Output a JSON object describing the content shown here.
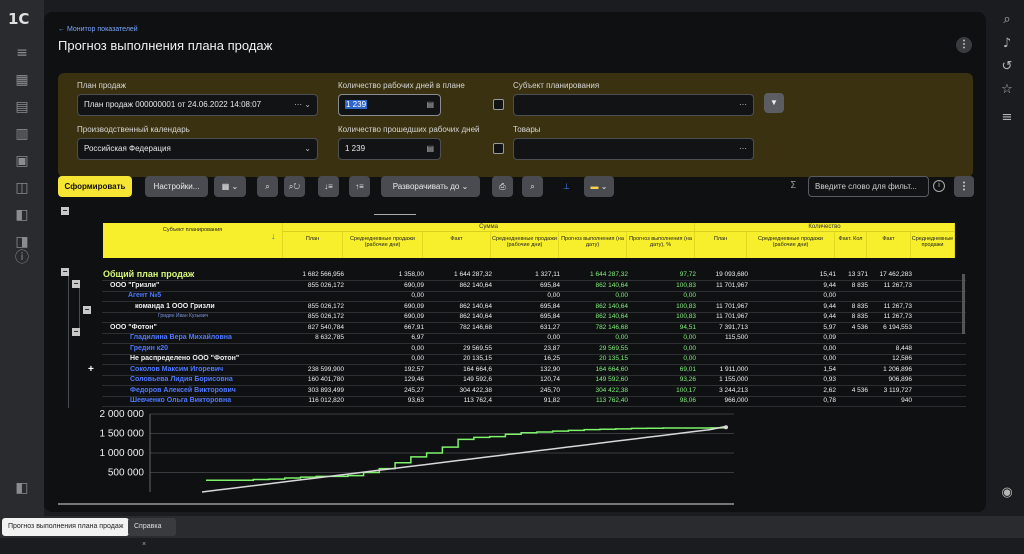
{
  "app": {
    "logo": "1С"
  },
  "header": {
    "back_link": "← Монитор показателей",
    "title": "Прогноз выполнения плана продаж"
  },
  "params": {
    "plan_label": "План продаж",
    "plan_value": "План продаж 000000001 от 24.06.2022 14:08:07",
    "workdays_label": "Количество рабочих дней в плане",
    "workdays_value": "1 239",
    "subject_label": "Субъект планирования",
    "calendar_label": "Производственный календарь",
    "calendar_value": "Российская Федерация",
    "passed_days_label": "Количество прошедших рабочих дней",
    "passed_days_value": "1 239",
    "goods_label": "Товары"
  },
  "toolbar": {
    "form_button": "Сформировать",
    "settings_button": "Настройки...",
    "expand_button": "Разворачивать до",
    "search_placeholder": "Введите слово для фильт...",
    "sigma": "Σ"
  },
  "report": {
    "header": {
      "subject": "Субъект планирования",
      "sums_group": "Сумма",
      "qty_group": "Количество",
      "columns": [
        "План",
        "Среднедневные продажи (рабочие дни)",
        "Факт",
        "Среднедневные продажи (рабочие дни)",
        "Прогноз выполнения (на дату)",
        "Прогноз выполнения (на дату), %"
      ],
      "qty_columns": [
        "План",
        "Среднедневные продажи (рабочие дни)",
        "Факт. Кол",
        "Факт",
        "Среднедневные продажи"
      ]
    },
    "rows": [
      {
        "name": "Общий план продаж",
        "c": [
          "1 682 566,956",
          "1 358,00",
          "1 644 287,32",
          "1 327,11",
          "1 644 287,32",
          "97,72",
          "19 093,680",
          "15,41",
          "13 371",
          "17 462,283"
        ]
      },
      {
        "name": "ООО \"Гризли\"",
        "c": [
          "855 026,172",
          "690,09",
          "862 140,64",
          "695,84",
          "862 140,64",
          "100,83",
          "11 701,967",
          "9,44",
          "8 835",
          "11 267,73"
        ]
      },
      {
        "name": "Агент №5",
        "c": [
          "",
          "0,00",
          "",
          "0,00",
          "0,00",
          "0,00",
          "",
          "0,00",
          "",
          ""
        ]
      },
      {
        "name": "команда 1 ООО Гризли",
        "c": [
          "855 026,172",
          "690,09",
          "862 140,64",
          "695,84",
          "862 140,64",
          "100,83",
          "11 701,967",
          "9,44",
          "8 835",
          "11 267,73"
        ]
      },
      {
        "name": "Гридин Иван Кузьмич",
        "c": [
          "855 026,172",
          "690,09",
          "862 140,64",
          "695,84",
          "862 140,64",
          "100,83",
          "11 701,967",
          "9,44",
          "8 835",
          "11 267,73"
        ]
      },
      {
        "name": "ООО \"Фотон\"",
        "c": [
          "827 540,784",
          "667,91",
          "782 146,68",
          "631,27",
          "782 146,68",
          "94,51",
          "7 391,713",
          "5,97",
          "4 536",
          "6 194,553"
        ]
      },
      {
        "name": "Гладилина Вера Михайловна",
        "c": [
          "8 632,785",
          "6,97",
          "",
          "0,00",
          "0,00",
          "0,00",
          "115,500",
          "0,09",
          "",
          ""
        ]
      },
      {
        "name": "Гредин к20",
        "c": [
          "",
          "0,00",
          "29 569,55",
          "23,87",
          "29 569,55",
          "0,00",
          "",
          "0,00",
          "",
          "8,448"
        ]
      },
      {
        "name": "Не распределено ООО \"Фотон\"",
        "c": [
          "",
          "0,00",
          "20 135,15",
          "16,25",
          "20 135,15",
          "0,00",
          "",
          "0,00",
          "",
          "12,586"
        ]
      },
      {
        "name": "Соколов Максим Игоревич",
        "c": [
          "238 599,900",
          "192,57",
          "164 664,6",
          "132,90",
          "164 664,60",
          "69,01",
          "1 911,000",
          "1,54",
          "",
          "1 206,896"
        ]
      },
      {
        "name": "Соловьева Лидия Борисовна",
        "c": [
          "160 401,780",
          "129,46",
          "149 592,6",
          "120,74",
          "149 592,60",
          "93,26",
          "1 155,000",
          "0,93",
          "",
          "906,896"
        ]
      },
      {
        "name": "Федоров Алексей Викторович",
        "c": [
          "303 893,499",
          "245,27",
          "304 422,38",
          "245,70",
          "304 422,38",
          "100,17",
          "3 244,213",
          "2,62",
          "4 536",
          "3 119,727"
        ]
      },
      {
        "name": "Шевченко Ольга Викторовна",
        "c": [
          "116 012,820",
          "93,63",
          "113 762,4",
          "91,82",
          "113 762,40",
          "98,06",
          "966,000",
          "0,78",
          "",
          "940"
        ]
      }
    ]
  },
  "chart_data": {
    "type": "line",
    "y_ticks": [
      "2 000 000",
      "1 500 000",
      "1 000 000",
      "500 000"
    ],
    "ylim": [
      0,
      2000000
    ],
    "series": [
      {
        "name": "",
        "color": "#7ef36a",
        "values": [
          300000,
          300000,
          300000,
          320000,
          330000,
          360000,
          380000,
          400000,
          400000,
          420000,
          500000,
          600000,
          750000,
          900000,
          1000000,
          1150000,
          1350000,
          1400000,
          1420000,
          1480000,
          1520000,
          1540000,
          1560000,
          1580000,
          1600000,
          1610000,
          1620000,
          1630000,
          1635000,
          1640000,
          1640000,
          1642000,
          1644000,
          1644287
        ]
      },
      {
        "name": "",
        "color": "#d8d8d8",
        "values": [
          0,
          50000,
          100000,
          150000,
          200000,
          250000,
          300000,
          350000,
          400000,
          450000,
          500000,
          550000,
          600000,
          650000,
          700000,
          750000,
          800000,
          850000,
          900000,
          950000,
          1000000,
          1050000,
          1100000,
          1150000,
          1200000,
          1250000,
          1300000,
          1350000,
          1400000,
          1450000,
          1500000,
          1550000,
          1600000,
          1682567
        ]
      }
    ]
  },
  "tabs": [
    {
      "label": "Прогноз выполнения плана продаж"
    },
    {
      "label": "Справка"
    }
  ]
}
